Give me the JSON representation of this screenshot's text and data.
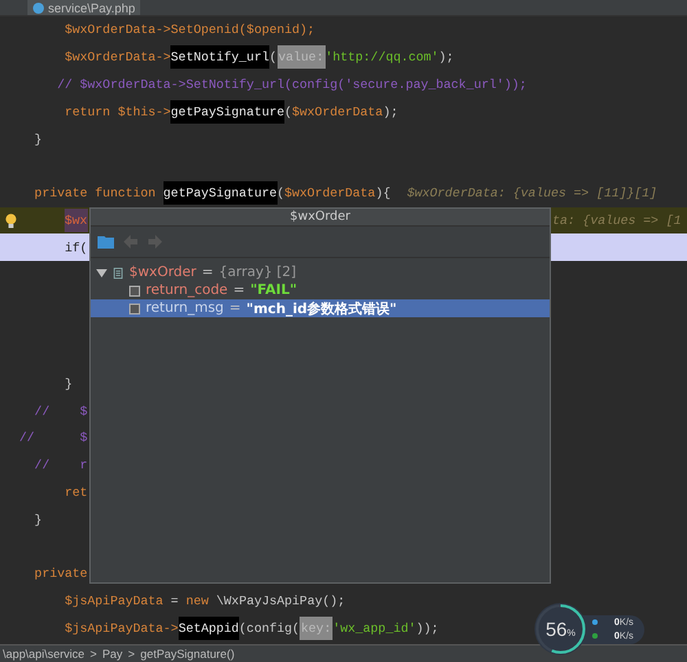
{
  "tab": {
    "label": "service\\Pay.php"
  },
  "code_lines": [
    {
      "kind": "normal",
      "tokens": [
        {
          "kind": "var",
          "text": "        $wxOrderData->SetOpenid($openid);"
        }
      ]
    },
    {
      "kind": "normal",
      "tokens": [
        {
          "kind": "var",
          "text": "        $wxOrderData->"
        },
        {
          "kind": "function",
          "text": "SetNotify_url"
        },
        {
          "kind": "plain",
          "text": "("
        },
        {
          "kind": "hint",
          "text": "value:"
        },
        {
          "kind": "string",
          "text": "'http://qq.com'"
        },
        {
          "kind": "plain",
          "text": ");"
        }
      ]
    },
    {
      "kind": "normal",
      "tokens": [
        {
          "kind": "comment",
          "text": "       // $wxOrderData->SetNotify_url(config('secure.pay_back_url'));"
        }
      ]
    },
    {
      "kind": "normal",
      "tokens": [
        {
          "kind": "keyword",
          "text": "        return $this->"
        },
        {
          "kind": "function",
          "text": "getPaySignature"
        },
        {
          "kind": "plain",
          "text": "("
        },
        {
          "kind": "var",
          "text": "$wxOrderData"
        },
        {
          "kind": "plain",
          "text": ");"
        }
      ]
    },
    {
      "kind": "normal",
      "tokens": [
        {
          "kind": "plain",
          "text": "    }"
        }
      ]
    },
    {
      "kind": "blank"
    },
    {
      "kind": "normal",
      "tokens": [
        {
          "kind": "keyword",
          "text": "    private function "
        },
        {
          "kind": "function",
          "text": "getPaySignature"
        },
        {
          "kind": "plain",
          "text": "("
        },
        {
          "kind": "var",
          "text": "$wxOrderData"
        },
        {
          "kind": "plain",
          "text": "){"
        },
        {
          "kind": "inlay",
          "text": "$wxOrderData: {values => [11]}[1]"
        }
      ]
    },
    {
      "kind": "warning",
      "tokens": [
        {
          "kind": "var_ref",
          "text": "$wx"
        },
        {
          "kind": "tail",
          "text": "ta: {values => [1"
        }
      ]
    },
    {
      "kind": "current",
      "tokens": [
        {
          "kind": "plain",
          "text": "        if("
        }
      ]
    },
    {
      "kind": "blank"
    },
    {
      "kind": "blank"
    },
    {
      "kind": "blank"
    },
    {
      "kind": "blank"
    },
    {
      "kind": "normal",
      "tokens": [
        {
          "kind": "plain",
          "text": "        }"
        }
      ]
    },
    {
      "kind": "normal",
      "tokens": [
        {
          "kind": "comment",
          "text": "    //    $"
        }
      ]
    },
    {
      "kind": "normal",
      "tokens": [
        {
          "kind": "comment",
          "text": "  //      $"
        }
      ]
    },
    {
      "kind": "normal",
      "tokens": [
        {
          "kind": "comment",
          "text": "    //    r"
        }
      ]
    },
    {
      "kind": "normal",
      "tokens": [
        {
          "kind": "keyword",
          "text": "        ret"
        }
      ]
    },
    {
      "kind": "normal",
      "tokens": [
        {
          "kind": "plain",
          "text": "    }"
        }
      ]
    },
    {
      "kind": "blank"
    },
    {
      "kind": "normal",
      "tokens": [
        {
          "kind": "keyword",
          "text": "    private"
        }
      ]
    },
    {
      "kind": "normal",
      "tokens": [
        {
          "kind": "var",
          "text": "        $jsApiPayData"
        },
        {
          "kind": "plain",
          "text": " = "
        },
        {
          "kind": "keyword",
          "text": "new"
        },
        {
          "kind": "plain",
          "text": " \\WxPayJsApiPay();"
        }
      ]
    },
    {
      "kind": "normal",
      "tokens": [
        {
          "kind": "var",
          "text": "        $jsApiPayData->"
        },
        {
          "kind": "function",
          "text": "SetAppid"
        },
        {
          "kind": "plain",
          "text": "(config("
        },
        {
          "kind": "hint",
          "text": "key:"
        },
        {
          "kind": "string",
          "text": "'wx_app_id'"
        },
        {
          "kind": "plain",
          "text": "));"
        }
      ]
    }
  ],
  "popup": {
    "title": "$wxOrder",
    "tree": [
      {
        "name": "$wxOrder",
        "sep": "=",
        "value": "{array} [2]",
        "kind": "array",
        "expanded": true,
        "selected": false,
        "children": [
          {
            "name": "return_code",
            "sep": "=",
            "value": "\"FAIL\"",
            "kind": "string",
            "selected": false
          },
          {
            "name": "return_msg",
            "sep": "=",
            "value": "\"mch_id参数格式错误\"",
            "kind": "string",
            "selected": true
          }
        ]
      }
    ]
  },
  "breadcrumb": {
    "separator": ">",
    "items": [
      "\\app\\api\\service",
      "Pay",
      "getPaySignature()"
    ]
  },
  "monitor": {
    "percent": "56",
    "unit": "%",
    "level": 0.56,
    "rates": [
      {
        "kind": "up",
        "value": "0",
        "unit": "K/s"
      },
      {
        "kind": "down",
        "value": "0",
        "unit": "K/s"
      }
    ]
  }
}
